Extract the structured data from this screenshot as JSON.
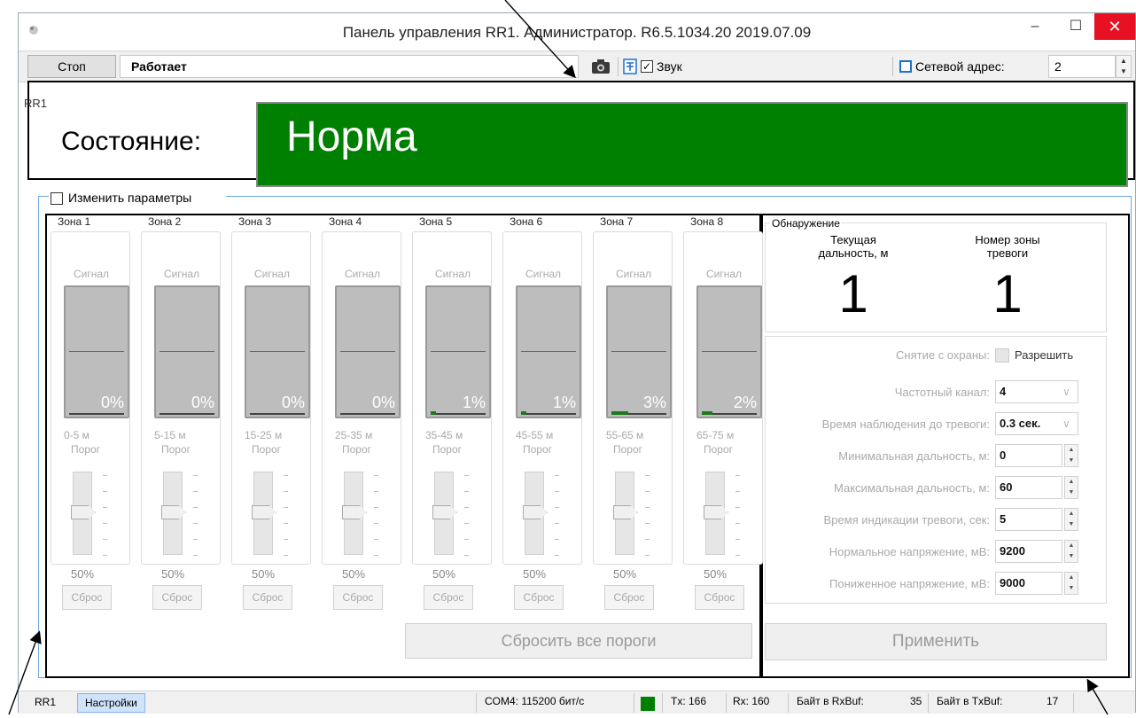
{
  "window": {
    "title": "Панель управления RR1. Администратор. R6.5.1034.20 2019.07.09",
    "minimize": "–",
    "maximize": "☐",
    "close": "✕"
  },
  "toolbar": {
    "stop_label": "Стоп",
    "status_text": "Работает",
    "sound_checked": "✓",
    "sound_label": "Звук",
    "address_label": "Сетевой адрес:",
    "address_value": "2",
    "spin_up": "▲",
    "spin_down": "▼"
  },
  "state": {
    "group_label": "RR1",
    "label": "Состояние:",
    "value": "Норма",
    "color": "#008000"
  },
  "params": {
    "checkbox_label": "Изменить параметры"
  },
  "zones": [
    {
      "title": "Зона 1",
      "signal": "Сигнал",
      "percent": "0%",
      "fill": 0,
      "range": "0-5 м",
      "threshold_label": "Порог",
      "threshold_value": "50%",
      "reset": "Сброс"
    },
    {
      "title": "Зона 2",
      "signal": "Сигнал",
      "percent": "0%",
      "fill": 0,
      "range": "5-15 м",
      "threshold_label": "Порог",
      "threshold_value": "50%",
      "reset": "Сброс"
    },
    {
      "title": "Зона 3",
      "signal": "Сигнал",
      "percent": "0%",
      "fill": 0,
      "range": "15-25 м",
      "threshold_label": "Порог",
      "threshold_value": "50%",
      "reset": "Сброс"
    },
    {
      "title": "Зона 4",
      "signal": "Сигнал",
      "percent": "0%",
      "fill": 0,
      "range": "25-35 м",
      "threshold_label": "Порог",
      "threshold_value": "50%",
      "reset": "Сброс"
    },
    {
      "title": "Зона 5",
      "signal": "Сигнал",
      "percent": "1%",
      "fill": 1,
      "range": "35-45 м",
      "threshold_label": "Порог",
      "threshold_value": "50%",
      "reset": "Сброс"
    },
    {
      "title": "Зона 6",
      "signal": "Сигнал",
      "percent": "1%",
      "fill": 1,
      "range": "45-55 м",
      "threshold_label": "Порог",
      "threshold_value": "50%",
      "reset": "Сброс"
    },
    {
      "title": "Зона 7",
      "signal": "Сигнал",
      "percent": "3%",
      "fill": 3,
      "range": "55-65 м",
      "threshold_label": "Порог",
      "threshold_value": "50%",
      "reset": "Сброс"
    },
    {
      "title": "Зона 8",
      "signal": "Сигнал",
      "percent": "2%",
      "fill": 2,
      "range": "65-75 м",
      "threshold_label": "Порог",
      "threshold_value": "50%",
      "reset": "Сброс"
    }
  ],
  "reset_all_label": "Сбросить все пороги",
  "detection": {
    "title": "Обнаружение",
    "current_distance_label": "Текущая дальность, м",
    "current_distance_value": "1",
    "alarm_zone_label": "Номер зоны тревоги",
    "alarm_zone_value": "1"
  },
  "settings": {
    "disarm_label": "Снятие с охраны:",
    "disarm_option": "Разрешить",
    "rows": [
      {
        "label": "Частотный канал:",
        "value": "4",
        "type": "dropdown"
      },
      {
        "label": "Время наблюдения до тревоги:",
        "value": "0.3 сек.",
        "type": "dropdown"
      },
      {
        "label": "Минимальная дальность, м:",
        "value": "0",
        "type": "spinner"
      },
      {
        "label": "Максимальная дальность, м:",
        "value": "60",
        "type": "spinner"
      },
      {
        "label": "Время индикации тревоги, сек:",
        "value": "5",
        "type": "spinner"
      },
      {
        "label": "Нормальное напряжение, мВ:",
        "value": "9200",
        "type": "spinner"
      },
      {
        "label": "Пониженное напряжение, мВ:",
        "value": "9000",
        "type": "spinner"
      }
    ],
    "dropdown_arrow": "∨"
  },
  "apply_label": "Применить",
  "statusbar": {
    "tab_rr1": "RR1",
    "tab_settings": "Настройки",
    "port": "COM4: 115200 бит/с",
    "tx": "Tx: 166",
    "rx": "Rx: 160",
    "rxbuf_label": "Байт в RxBuf:",
    "rxbuf_value": "35",
    "txbuf_label": "Байт в TxBuf:",
    "txbuf_value": "17"
  }
}
